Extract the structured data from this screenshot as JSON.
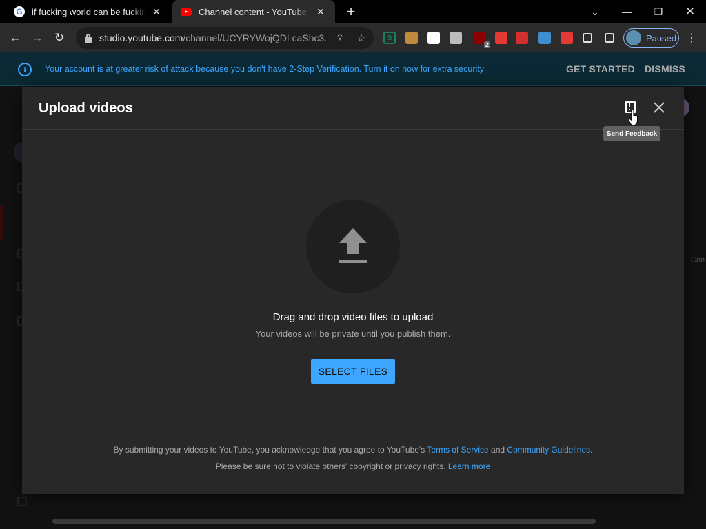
{
  "browser": {
    "tabs": [
      {
        "title": "if fucking world can be fucking an",
        "favicon": "google-icon",
        "active": false
      },
      {
        "title": "Channel content - YouTube Studio",
        "favicon": "youtube-icon",
        "active": true
      }
    ],
    "url_host": "studio.youtube.com",
    "url_path": "/channel/UCYRYWojQDLcaShc3...",
    "profile_label": "Paused",
    "extensions": [
      {
        "name": "s-extension-icon",
        "label": "S",
        "color": "#1e7f5c"
      },
      {
        "name": "cookie-extension-icon",
        "label": "",
        "color": "#c08a3e"
      },
      {
        "name": "owl-extension-icon",
        "label": "",
        "color": "#ffffff"
      },
      {
        "name": "window-extension-icon",
        "label": "",
        "color": "#bdbdbd"
      },
      {
        "name": "ublock-extension-icon",
        "label": "2",
        "color": "#8b0000"
      },
      {
        "name": "red-circle-extension-icon",
        "label": "",
        "color": "#e53935"
      },
      {
        "name": "red-bar-extension-icon",
        "label": "",
        "color": "#d32f2f"
      },
      {
        "name": "blue-square-extension-icon",
        "label": "",
        "color": "#3e8ed0"
      },
      {
        "name": "heart-extension-icon",
        "label": "",
        "color": "#e53935"
      },
      {
        "name": "puzzle-extensions-icon",
        "label": "",
        "color": "#e3e3e3"
      },
      {
        "name": "sidepanel-icon",
        "label": "",
        "color": "#e3e3e3"
      }
    ]
  },
  "banner": {
    "message": "Your account is at greater risk of attack because you don't have 2-Step Verification. Turn it on now for extra security",
    "get_started": "GET STARTED",
    "dismiss": "DISMISS"
  },
  "dialog": {
    "title": "Upload videos",
    "tooltip": "Send Feedback",
    "drag_title": "Drag and drop video files to upload",
    "drag_subtitle": "Your videos will be private until you publish them.",
    "select_button": "SELECT FILES",
    "legal_line1_prefix": "By submitting your videos to YouTube, you acknowledge that you agree to YouTube's ",
    "terms_link": "Terms of Service",
    "and_text": " and ",
    "guidelines_link": "Community Guidelines",
    "period": ".",
    "legal_line2_prefix": "Please be sure not to violate others' copyright or privacy rights. ",
    "learn_more_link": "Learn more"
  },
  "background": {
    "right_peek_text": "Con"
  },
  "colors": {
    "accent_blue": "#3ea6ff",
    "dialog_bg": "#282828",
    "banner_bg": "#0b2a35"
  }
}
